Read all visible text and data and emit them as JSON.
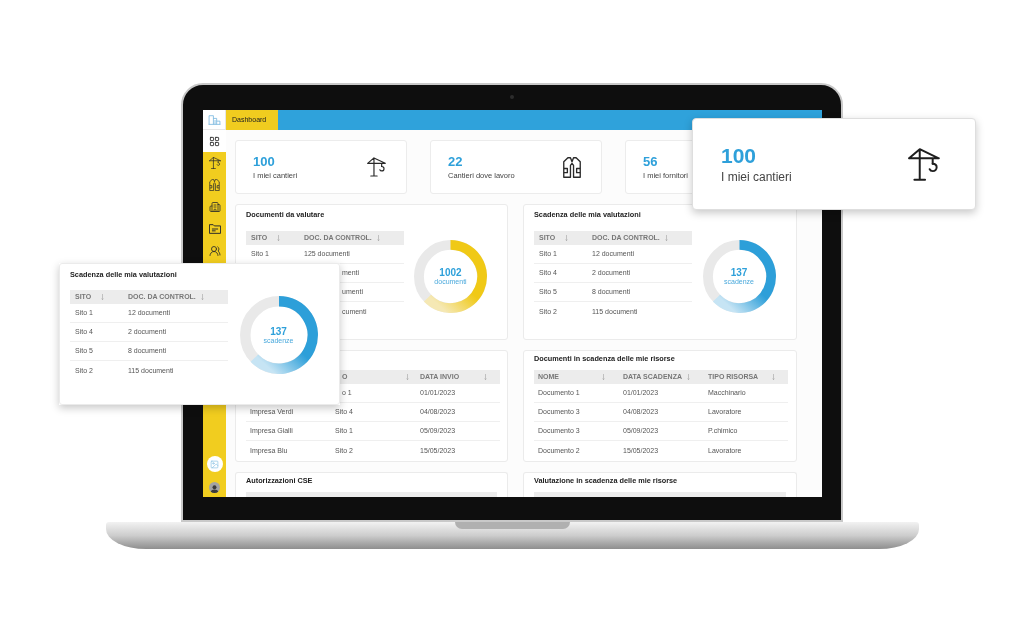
{
  "sidebar": {
    "items": [
      {
        "selected": true
      },
      {
        "selected": false
      },
      {
        "selected": false
      },
      {
        "selected": false
      },
      {
        "selected": false
      },
      {
        "selected": false
      }
    ]
  },
  "top_bar": {
    "tabs": [
      {
        "label": "Dashboard",
        "selected": true
      }
    ]
  },
  "stat_cards": [
    {
      "value": "100",
      "label": "I miei cantieri"
    },
    {
      "value": "22",
      "label": "Cantieri dove lavoro"
    },
    {
      "value": "56",
      "label": "I miei fornitori"
    }
  ],
  "widgets": [
    {
      "title": "Documenti da valutare",
      "table": {
        "columns": [
          "SITO",
          "DOC. DA CONTROL."
        ],
        "rows": [
          [
            "Sito 1",
            "125 documenti"
          ],
          [
            null,
            "menti"
          ],
          [
            null,
            "umenti"
          ],
          [
            null,
            "cumenti"
          ]
        ]
      },
      "donut": {
        "value": "1002",
        "label": "documenti"
      }
    },
    {
      "table": {
        "columns": [
          null,
          "O",
          "DATA INVIO"
        ],
        "rows": [
          [
            null,
            "o 1",
            "01/01/2023"
          ],
          [
            "Impresa Verdi",
            "Sito 4",
            "04/08/2023"
          ],
          [
            "Impresa Gialli",
            "Sito 1",
            "05/09/2023"
          ],
          [
            "Impresa Blu",
            "Sito 2",
            "15/05/2023"
          ]
        ]
      }
    },
    {
      "title": "Autorizzazioni CSE"
    },
    {
      "title": "Scadenza delle mia valutazioni",
      "table": {
        "columns": [
          "SITO",
          "DOC. DA CONTROL."
        ],
        "rows": [
          [
            "Sito 1",
            "12 documenti"
          ],
          [
            "Sito 4",
            "2 documenti"
          ],
          [
            "Sito 5",
            "8 documenti"
          ],
          [
            "Sito 2",
            "115 documenti"
          ]
        ]
      },
      "donut": {
        "value": "137",
        "label": "scadenze"
      }
    },
    {
      "title": "Documenti in scadenza delle mie risorse",
      "table": {
        "columns": [
          "NOME",
          "DATA SCADENZA",
          "TIPO RISORSA"
        ],
        "rows": [
          [
            "Documento 1",
            "01/01/2023",
            "Macchinario"
          ],
          [
            "Documento 3",
            "04/08/2023",
            "Lavoratore"
          ],
          [
            "Documento 3",
            "05/09/2023",
            "P.chimico"
          ],
          [
            "Documento 2",
            "15/05/2023",
            "Lavoratore"
          ]
        ]
      }
    },
    {
      "title": "Valutazione in scadenza delle mie risorse"
    }
  ],
  "callouts": {
    "stat_card": {
      "value": "100",
      "label": "I miei cantieri"
    },
    "widget": {
      "title": "Scadenza delle mia valutazioni",
      "table": {
        "columns": [
          "SITO",
          "DOC. DA CONTROL."
        ],
        "rows": [
          [
            "Sito 1",
            "12 documenti"
          ],
          [
            "Sito 4",
            "2 documenti"
          ],
          [
            "Sito 5",
            "8 documenti"
          ],
          [
            "Sito 2",
            "115 documenti"
          ]
        ]
      },
      "donut": {
        "value": "137",
        "label": "scadenze"
      }
    }
  }
}
